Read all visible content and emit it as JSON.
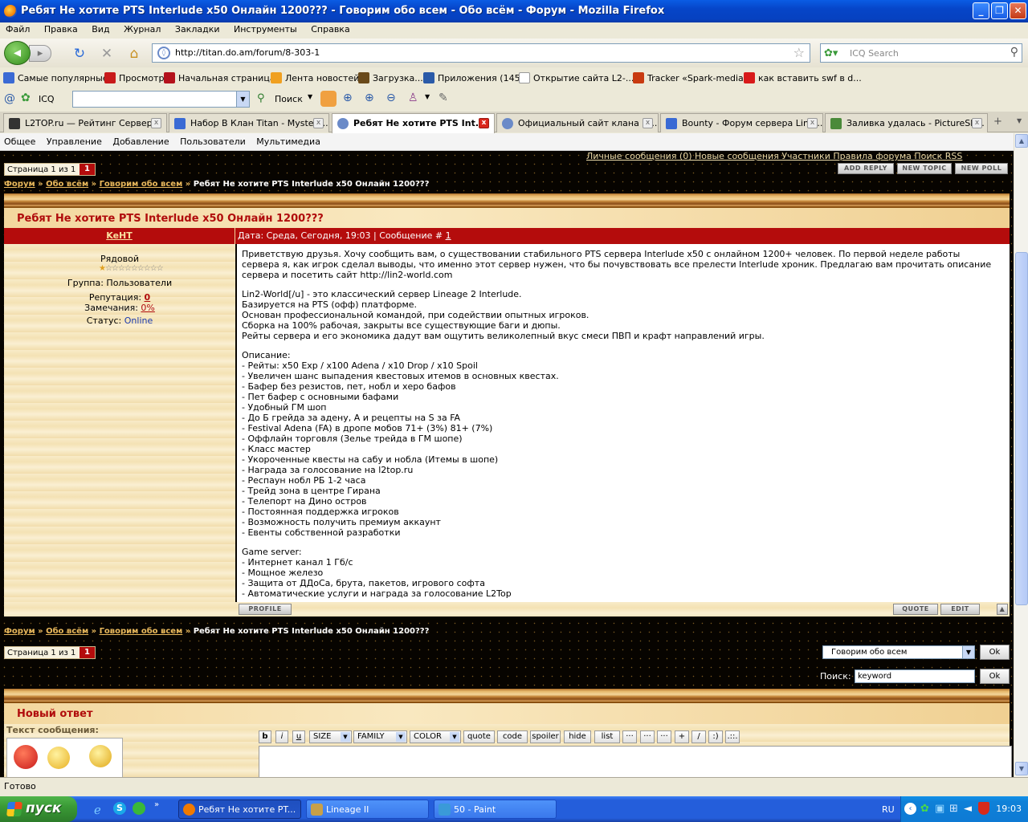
{
  "window": {
    "title": "Ребят Не хотите PTS Interlude x50 Онлайн 1200??? - Говорим обо всем - Обо всём - Форум - Mozilla Firefox",
    "min_glyph": "_",
    "max_glyph": "❐",
    "close_glyph": "✕"
  },
  "menu": [
    "Файл",
    "Правка",
    "Вид",
    "Журнал",
    "Закладки",
    "Инструменты",
    "Справка"
  ],
  "nav": {
    "url": "http://titan.do.am/forum/8-303-1",
    "search_placeholder": "ICQ Search"
  },
  "bookmarks": [
    {
      "label": "Самые популярные",
      "color": "#3a6ad4"
    },
    {
      "label": "Просмотр",
      "color": "#c81a1a"
    },
    {
      "label": "Начальная страница",
      "color": "#b4121c"
    },
    {
      "label": "Лента новостей",
      "color": "#f0a020"
    },
    {
      "label": "Загрузка...",
      "color": "#6a4a1a"
    },
    {
      "label": "Приложения (145)",
      "color": "#2a5aa8"
    },
    {
      "label": "Открытие сайта L2-...",
      "color": "#ffffff"
    },
    {
      "label": "Tracker «Spark-media»",
      "color": "#c83a10"
    },
    {
      "label": "как вставить swf в d...",
      "color": "#d81a1a"
    }
  ],
  "icqbar": {
    "icq_label": "ICQ",
    "search_label": "Поиск"
  },
  "tabs": [
    {
      "label": "L2TOP.ru — Рейтинг Сервер...",
      "color": "#333333",
      "active": false
    },
    {
      "label": "Набор В Клан Titan - Mysteri...",
      "color": "#3a6ad4",
      "active": false
    },
    {
      "label": "Ребят Не хотите PTS Int...",
      "color": "#6a8ac8",
      "active": true
    },
    {
      "label": "Официальный сайт клана Fi...",
      "color": "#6a8ac8",
      "active": false
    },
    {
      "label": "Bounty - Форум сервера Lin2...",
      "color": "#3a6ad4",
      "active": false
    },
    {
      "label": "Заливка удалась - PictureSh...",
      "color": "#4a8a3a",
      "active": false
    }
  ],
  "ucoz_menu": [
    "Общее",
    "Управление",
    "Добавление",
    "Пользователи",
    "Мультимедиа"
  ],
  "forum": {
    "top_links": "Личные сообщения (0)    Новые сообщения    Участники    Правила форума    Поиск    RSS",
    "pager_text": "Страница 1 из 1",
    "pager_num": "1",
    "btn_reply": "ADD REPLY",
    "btn_topic": "NEW TOPIC",
    "btn_poll": "NEW POLL",
    "crumbs": [
      "Форум",
      "Обо всём",
      "Говорим обо всем"
    ],
    "crumb_sep": "»",
    "topic_title": "Ребят Не хотите PTS Interlude x50 Онлайн 1200???",
    "author": "KeHT",
    "post_header_prefix": "Дата: Среда, Сегодня, 19:03 | Сообщение # ",
    "post_number": "1",
    "user": {
      "rank": "Рядовой",
      "group": "Группа: Пользователи",
      "rep_label": "Репутация:",
      "rep_value": "0",
      "warn_label": "Замечания:",
      "warn_value": "0%",
      "status_label": "Статус:",
      "status_value": "Online"
    },
    "post_lines": [
      "Приветствую друзья. Хочу сообщить вам, о существовании стабильного PTS сервера Interlude x50 с онлайном 1200+ человек. По первой неделе работы",
      "сервера я, как игрок сделал выводы, что именно этот сервер нужен, что бы почувствовать все прелести Interlude хроник. Предлагаю вам прочитать описание",
      "сервера и посетить сайт http://lin2-world.com",
      "",
      "Lin2-World[/u] - это классический сервер Lineage 2 Interlude.",
      "Базируется на PTS (офф) платформе.",
      "Основан профессиональной командой, при содействии опытных игроков.",
      "Сборка на 100% рабочая, закрыты все существующие баги и дюпы.",
      "Рейты сервера и его экономика дадут вам ощутить великолепный вкус смеси ПВП и крафт направлений игры.",
      "",
      "Описание:",
      "- Рейты: x50 Exp / x100 Adena / x10 Drop / x10 Spoil",
      "- Увеличен шанс выпадения квестовых итемов в основных квестах.",
      "- Бафер без резистов, пет, нобл и херо бафов",
      "- Пет бафер с основными бафами",
      "- Удобный ГМ шоп",
      "- До Б грейда за адену, А и рецепты на S за FA",
      "- Festival Adena (FA) в дропе мобов 71+ (3%) 81+ (7%)",
      "- Оффлайн торговля (Зелье трейда в ГМ шопе)",
      "- Класс мастер",
      "- Укороченные квесты на сабу и нобла (Итемы в шопе)",
      "- Награда за голосование на l2top.ru",
      "- Респаун нобл РБ 1-2 часа",
      "- Трейд зона в центре Гирана",
      "- Телепорт на Дино остров",
      "- Постоянная поддержка игроков",
      "- Возможность получить премиум аккаунт",
      "- Евенты собственной разработки",
      "",
      "Game server:",
      "- Интернет канал 1 Гб/с",
      "- Мощное железо",
      "- Защита от ДДоСа, брута, пакетов, игрового софта",
      "- Автоматические услуги и награда за голосование L2Top"
    ],
    "btn_profile": "PROFILE",
    "btn_quote": "QUOTE",
    "btn_edit": "EDIT",
    "forum_select": "Говорим обо всем",
    "ok": "Ok",
    "search_label": "Поиск:",
    "search_value": "keyword",
    "reply_title": "Новый ответ",
    "msg_label": "Текст сообщения:",
    "editor_buttons": [
      "b",
      "i",
      "u",
      "SIZE",
      "FAMILY",
      "COLOR",
      "quote",
      "code",
      "spoiler",
      "hide",
      "list",
      "···",
      "···",
      "···",
      "+",
      "/",
      ":)",
      ".::."
    ]
  },
  "status": "Готово",
  "taskbar": {
    "start": "пуск",
    "buttons": [
      {
        "label": "Ребят Не хотите PT...",
        "color": "#f27a00"
      },
      {
        "label": "Lineage II",
        "color": "#c8a048"
      },
      {
        "label": "50 - Paint",
        "color": "#3a9ad8"
      }
    ],
    "lang": "RU",
    "clock": "19:03"
  }
}
